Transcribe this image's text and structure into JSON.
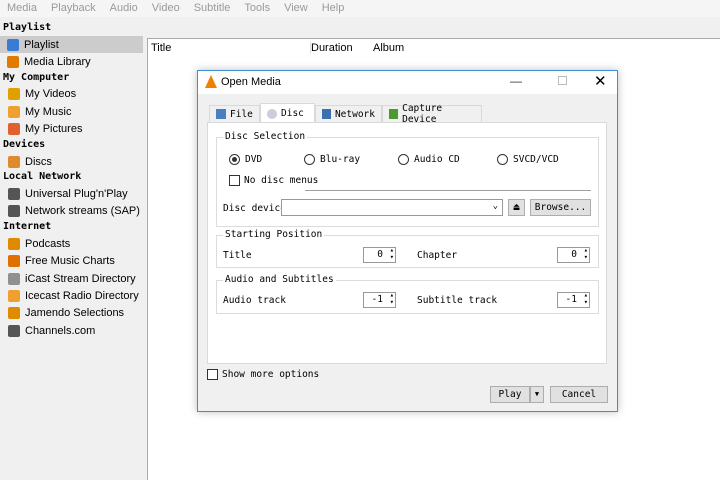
{
  "menu": [
    "Media",
    "Playback",
    "Audio",
    "Video",
    "Subtitle",
    "Tools",
    "View",
    "Help"
  ],
  "sidebar": {
    "sections": [
      {
        "title": "Playlist",
        "items": [
          {
            "label": "Playlist",
            "icon": "playlist-icon",
            "color": "#3a7bd5"
          },
          {
            "label": "Media Library",
            "icon": "media-library-icon",
            "color": "#e07b00"
          }
        ]
      },
      {
        "title": "My Computer",
        "items": [
          {
            "label": "My Videos",
            "icon": "film-icon",
            "color": "#e0a000"
          },
          {
            "label": "My Music",
            "icon": "music-note-icon",
            "color": "#f0a030"
          },
          {
            "label": "My Pictures",
            "icon": "picture-icon",
            "color": "#e06030"
          }
        ]
      },
      {
        "title": "Devices",
        "items": [
          {
            "label": "Discs",
            "icon": "disc-icon",
            "color": "#e08a30"
          }
        ]
      },
      {
        "title": "Local Network",
        "items": [
          {
            "label": "Universal Plug'n'Play",
            "icon": "network-icon",
            "color": "#555555"
          },
          {
            "label": "Network streams (SAP)",
            "icon": "network-icon",
            "color": "#555555"
          }
        ]
      },
      {
        "title": "Internet",
        "items": [
          {
            "label": "Podcasts",
            "icon": "podcast-icon",
            "color": "#e08a00"
          },
          {
            "label": "Free Music Charts",
            "icon": "charts-icon",
            "color": "#e07000"
          },
          {
            "label": "iCast Stream Directory",
            "icon": "icast-icon",
            "color": "#909090"
          },
          {
            "label": "Icecast Radio Directory",
            "icon": "icecast-icon",
            "color": "#f0a030"
          },
          {
            "label": "Jamendo Selections",
            "icon": "jamendo-icon",
            "color": "#e08a00"
          },
          {
            "label": "Channels.com",
            "icon": "channels-icon",
            "color": "#555555"
          }
        ]
      }
    ]
  },
  "playlist": {
    "columns": [
      "Title",
      "Duration",
      "Album"
    ]
  },
  "dialog": {
    "title": "Open Media",
    "tabs": [
      "File",
      "Disc",
      "Network",
      "Capture Device"
    ],
    "disc_selection": {
      "label": "Disc Selection",
      "options": [
        "DVD",
        "Blu-ray",
        "Audio CD",
        "SVCD/VCD"
      ],
      "selected": "DVD",
      "no_menus": "No disc menus",
      "device_label": "Disc device",
      "device_value": "",
      "browse": "Browse..."
    },
    "starting": {
      "label": "Starting Position",
      "title_label": "Title",
      "title_value": "0",
      "chapter_label": "Chapter",
      "chapter_value": "0"
    },
    "audio": {
      "label": "Audio and Subtitles",
      "audio_label": "Audio track",
      "audio_value": "-1",
      "sub_label": "Subtitle track",
      "sub_value": "-1"
    },
    "show_more": "Show more options",
    "play": "Play",
    "cancel": "Cancel"
  }
}
